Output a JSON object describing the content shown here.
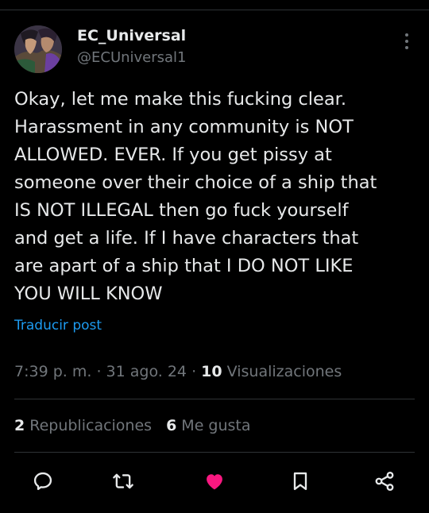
{
  "post": {
    "author": {
      "display_name": "EC_Universal",
      "handle": "@ECUniversal1",
      "avatar_icon": "profile-avatar"
    },
    "text": "Okay, let me make this fucking clear.\nHarassment in any community is NOT\nALLOWED. EVER. If you get pissy at\nsomeone over their choice of a ship that\nIS NOT ILLEGAL then go fuck yourself\nand get a life. If I have characters that\nare apart of a ship that I DO NOT LIKE\nYOU WILL KNOW",
    "translate_link": "Traducir post",
    "time": "7:39 p. m.",
    "separator": "·",
    "date": "31 ago. 24",
    "views_count": "10",
    "views_label": "Visualizaciones",
    "reposts_count": "2",
    "reposts_label": "Republicaciones",
    "likes_count": "6",
    "likes_label": "Me gusta"
  },
  "actions": {
    "reply_icon": "reply-icon",
    "repost_icon": "repost-icon",
    "like_icon": "heart-icon",
    "bookmark_icon": "bookmark-icon",
    "share_icon": "share-icon"
  },
  "colors": {
    "background": "#000000",
    "text": "#e7e9ea",
    "secondary": "#71767b",
    "link": "#1d9bf0",
    "like": "#f91880",
    "divider": "#2f3336"
  }
}
